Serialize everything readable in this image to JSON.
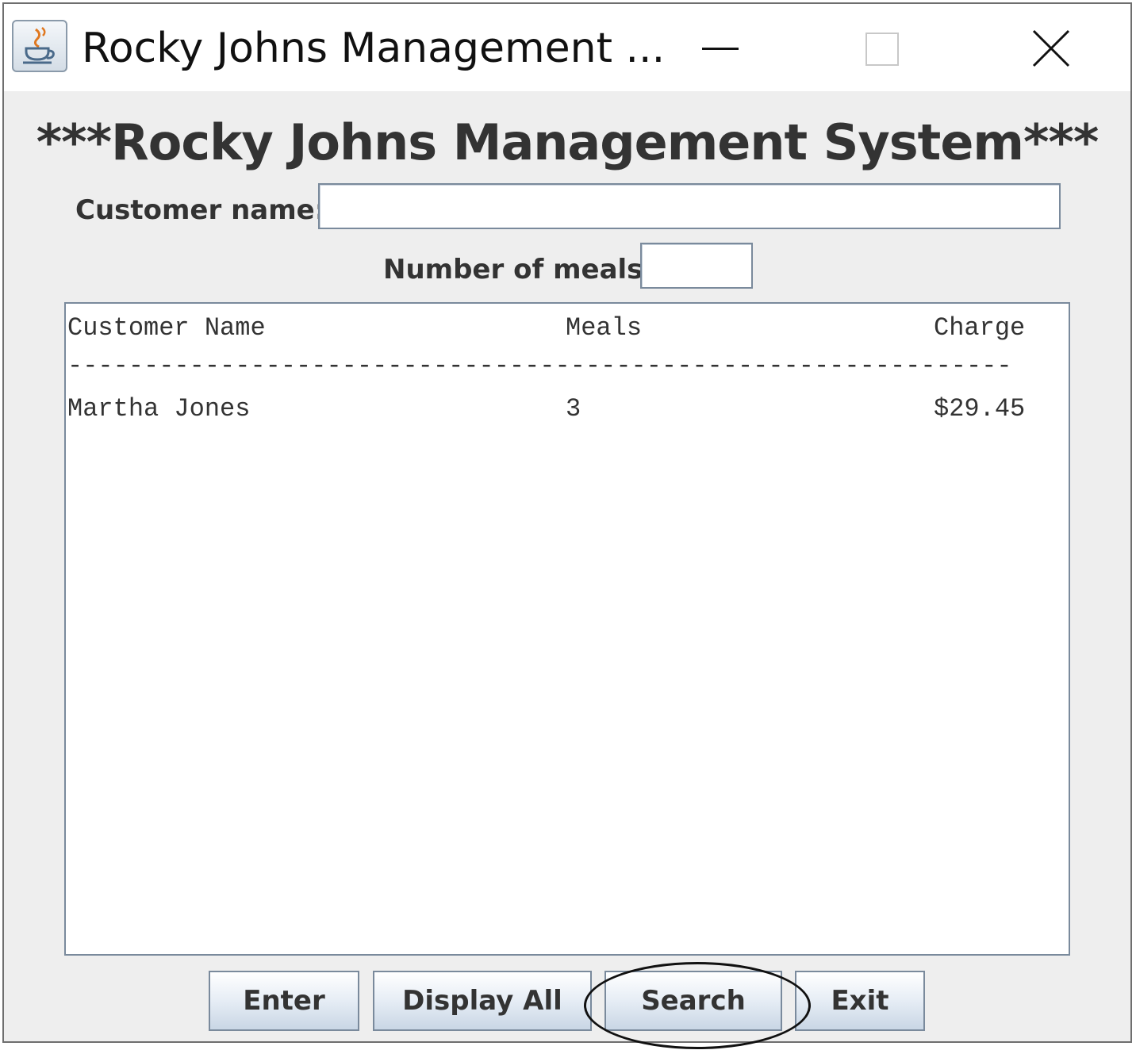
{
  "window": {
    "title": "Rocky Johns Management ...",
    "controls": [
      "minimize-icon",
      "maximize-icon",
      "close-icon"
    ]
  },
  "form": {
    "heading": "***Rocky Johns Management System***",
    "customer_name_label": "Customer name:",
    "customer_name_value": "",
    "meals_label": "Number of meals:",
    "meals_value": ""
  },
  "output": {
    "headers": [
      "Customer Name",
      "Meals",
      "Charge"
    ],
    "divider": "--------------------------------------------------------------",
    "rows": [
      {
        "name": "Martha Jones",
        "meals": "3",
        "charge": "$29.45"
      }
    ]
  },
  "buttons": {
    "enter": "Enter",
    "display_all": "Display All",
    "search": "Search",
    "exit": "Exit"
  },
  "annotation": {
    "highlighted_button": "Search"
  }
}
